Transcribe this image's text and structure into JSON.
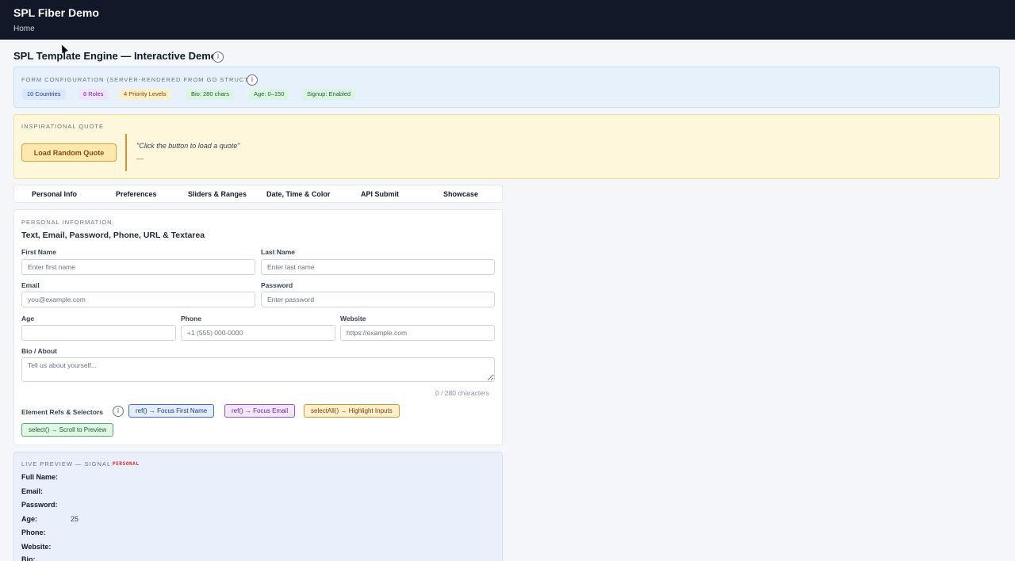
{
  "header": {
    "brand": "SPL Fiber Demo",
    "home_link": "Home"
  },
  "page": {
    "title": "SPL Template Engine — Interactive Demo",
    "info_icon": "i"
  },
  "config": {
    "label": "FORM CONFIGURATION (SERVER-RENDERED FROM GO STRUCTS)",
    "chips": [
      {
        "text": "10 Countries",
        "bg": "#dbe7fb",
        "fg": "#1e3a8a"
      },
      {
        "text": "6 Roles",
        "bg": "#f1e3fb",
        "fg": "#6b21a8"
      },
      {
        "text": "4 Priority Levels",
        "bg": "#fdf0c8",
        "fg": "#92400e"
      },
      {
        "text": "Bio: 280 chars",
        "bg": "#dcf5e3",
        "fg": "#166534"
      },
      {
        "text": "Age: 0–150",
        "bg": "#dcf5e3",
        "fg": "#166534"
      },
      {
        "text": "Signup: Enabled",
        "bg": "#dcf5e3",
        "fg": "#166534"
      }
    ]
  },
  "quote": {
    "label": "INSPIRATIONAL QUOTE",
    "button": "Load Random Quote",
    "text": "\"Click the button to load a quote\"",
    "author": "—"
  },
  "tabs": [
    "Personal Info",
    "Preferences",
    "Sliders & Ranges",
    "Date, Time & Color",
    "API Submit",
    "Showcase"
  ],
  "form": {
    "section": "PERSONAL INFORMATION",
    "title": "Text, Email, Password, Phone, URL & Textarea",
    "first_name": {
      "label": "First Name",
      "placeholder": "Enter first name"
    },
    "last_name": {
      "label": "Last Name",
      "placeholder": "Enter last name"
    },
    "email": {
      "label": "Email",
      "placeholder": "you@example.com"
    },
    "password": {
      "label": "Password",
      "placeholder": "Enter password"
    },
    "age": {
      "label": "Age",
      "value": ""
    },
    "phone": {
      "label": "Phone",
      "placeholder": "+1 (555) 000-0000"
    },
    "website": {
      "label": "Website",
      "placeholder": "https://example.com"
    },
    "bio": {
      "label": "Bio / About",
      "placeholder": "Tell us about yourself..."
    },
    "counter": "0 / 280 characters"
  },
  "refs": {
    "label": "Element Refs & Selectors",
    "buttons": [
      {
        "text": "ref() → Focus First Name",
        "bg": "#e3edfb",
        "border": "#3b6fd6",
        "fg": "#1e3a8a"
      },
      {
        "text": "ref() → Focus Email",
        "bg": "#f3e6fb",
        "border": "#9b4fd1",
        "fg": "#6b21a8"
      },
      {
        "text": "selectAll() → Highlight Inputs",
        "bg": "#fdf0cc",
        "border": "#d8972c",
        "fg": "#7c3a06"
      },
      {
        "text": "select() → Scroll to Preview",
        "bg": "#e2f6e6",
        "border": "#4caf6a",
        "fg": "#166534"
      }
    ]
  },
  "preview": {
    "label": "LIVE PREVIEW — SIGNAL:",
    "signal": "PERSONAL",
    "rows": [
      {
        "key": "Full Name:",
        "value": ""
      },
      {
        "key": "Email:",
        "value": ""
      },
      {
        "key": "Password:",
        "value": ""
      },
      {
        "key": "Age:",
        "value": "25"
      },
      {
        "key": "Phone:",
        "value": ""
      },
      {
        "key": "Website:",
        "value": ""
      },
      {
        "key": "Bio:",
        "value": ""
      }
    ]
  }
}
